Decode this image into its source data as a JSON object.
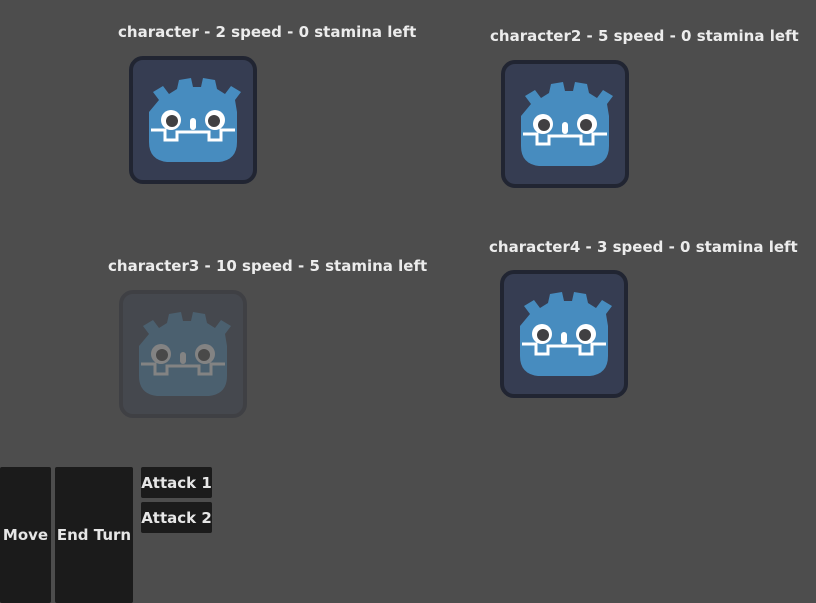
{
  "colors": {
    "background": "#4d4d4d",
    "button_bg": "#1b1b1b",
    "icon_frame": "#363d52",
    "icon_border": "#212532",
    "godot_blue": "#478cbf"
  },
  "characters": [
    {
      "label": "character - 2 speed - 0 stamina left",
      "icon": "godot-icon",
      "active": true
    },
    {
      "label": "character2 - 5 speed - 0 stamina left",
      "icon": "godot-icon",
      "active": true
    },
    {
      "label": "character3 - 10 speed - 5 stamina left",
      "icon": "godot-icon",
      "active": false
    },
    {
      "label": "character4 - 3 speed - 0 stamina left",
      "icon": "godot-icon",
      "active": true
    }
  ],
  "actions": {
    "move": "Move",
    "end_turn": "End Turn",
    "attack1": "Attack 1",
    "attack2": "Attack 2"
  }
}
